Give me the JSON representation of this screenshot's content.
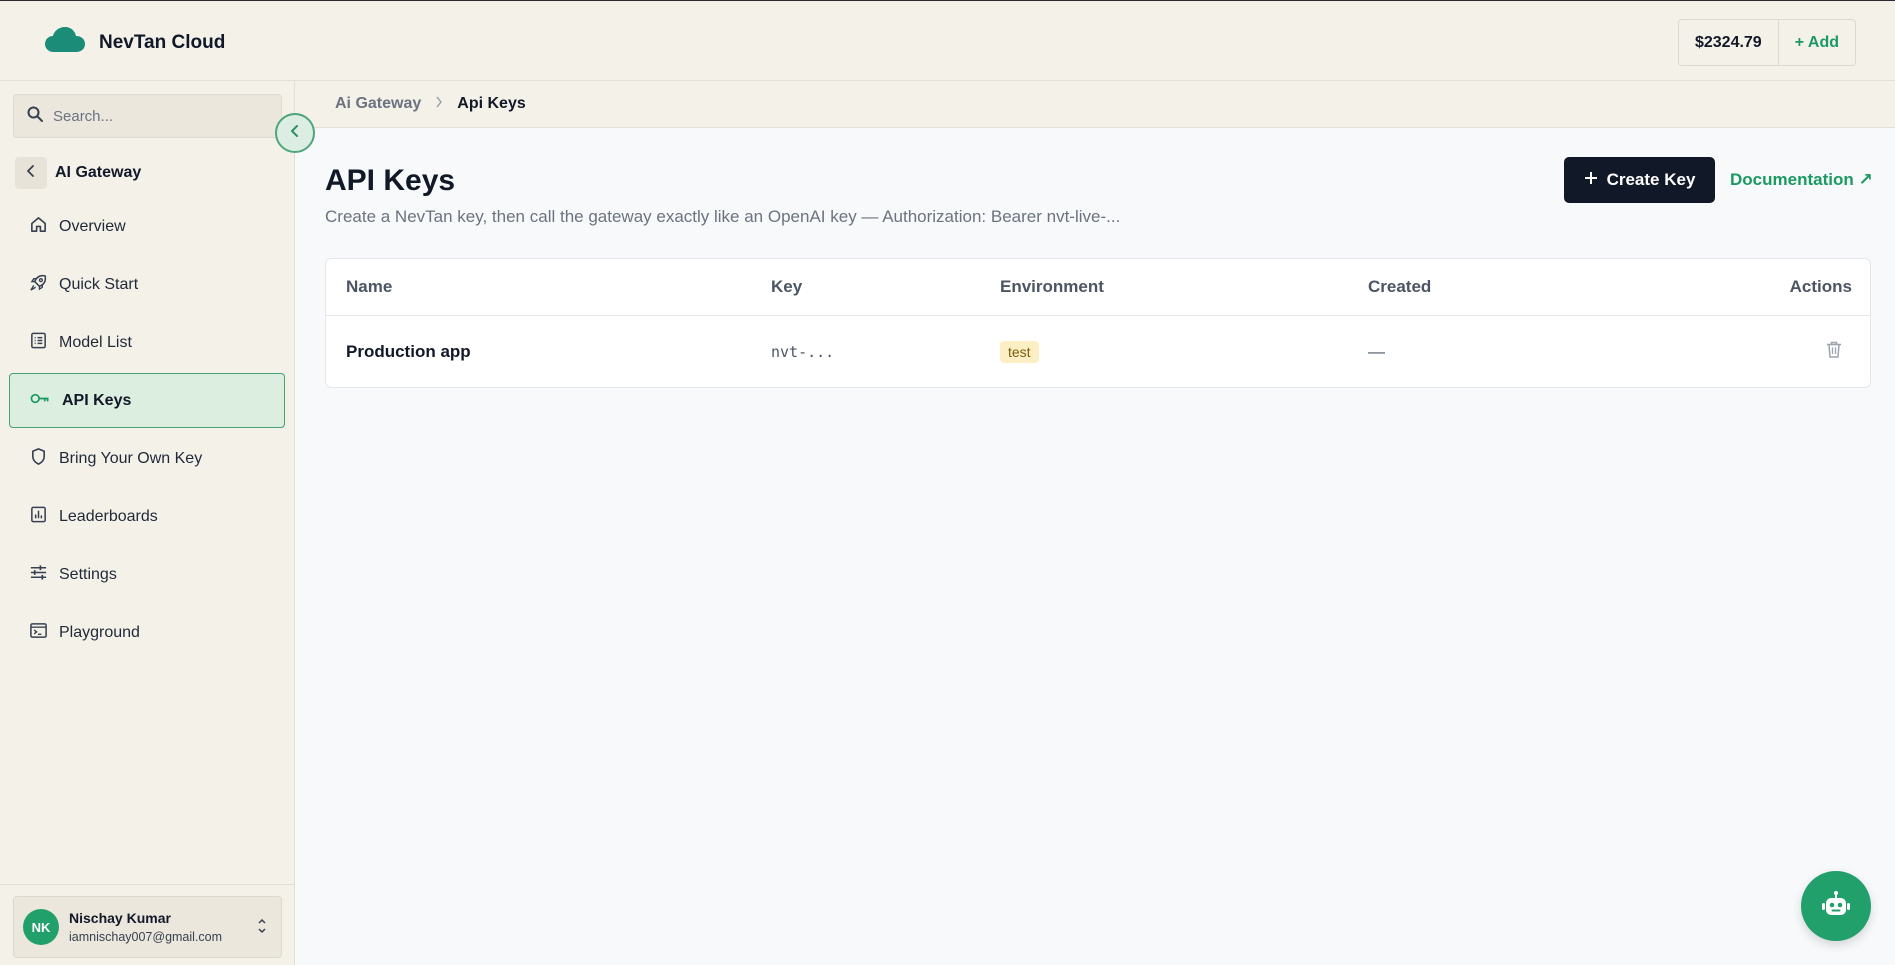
{
  "header": {
    "brand_name": "NevTan Cloud",
    "balance": "$2324.79",
    "add_label": "+ Add"
  },
  "sidebar": {
    "search_placeholder": "Search...",
    "section_title": "AI Gateway",
    "items": [
      {
        "label": "Overview",
        "icon": "home-icon"
      },
      {
        "label": "Quick Start",
        "icon": "rocket-icon"
      },
      {
        "label": "Model List",
        "icon": "list-icon"
      },
      {
        "label": "API Keys",
        "icon": "key-icon",
        "active": true
      },
      {
        "label": "Bring Your Own Key",
        "icon": "shield-icon"
      },
      {
        "label": "Leaderboards",
        "icon": "bar-chart-icon"
      },
      {
        "label": "Settings",
        "icon": "sliders-icon"
      },
      {
        "label": "Playground",
        "icon": "terminal-icon"
      }
    ],
    "user": {
      "initials": "NK",
      "name": "Nischay Kumar",
      "email": "iamnischay007@gmail.com"
    }
  },
  "breadcrumb": {
    "parent": "Ai Gateway",
    "current": "Api Keys"
  },
  "main": {
    "title": "API Keys",
    "subtitle": "Create a NevTan key, then call the gateway exactly like an OpenAI key — Authorization: Bearer nvt-live-...",
    "create_label": "Create Key",
    "doc_label": "Documentation ↗",
    "table": {
      "columns": [
        "Name",
        "Key",
        "Environment",
        "Created",
        "Actions"
      ],
      "rows": [
        {
          "name": "Production app",
          "key": "nvt-...",
          "environment": "test",
          "created": "—"
        }
      ]
    }
  },
  "colors": {
    "accent": "#22a06b",
    "primary_button": "#111827",
    "active_nav_bg": "#dbeedf",
    "env_badge_bg": "#fdefc3"
  }
}
